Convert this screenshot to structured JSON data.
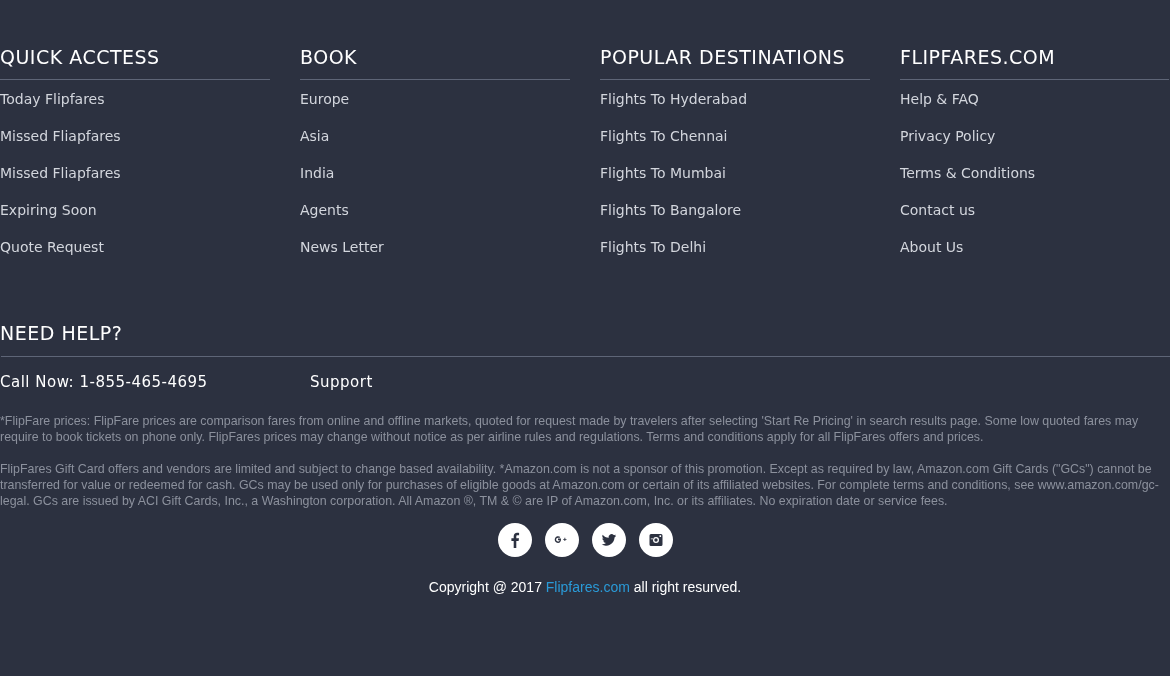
{
  "columns": [
    {
      "title": "QUICK ACCTESS",
      "links": [
        "Today Flipfares",
        "Missed Fliapfares",
        "Missed Fliapfares",
        "Expiring Soon",
        "Quote Request"
      ]
    },
    {
      "title": "BOOK",
      "links": [
        "Europe",
        "Asia",
        "India",
        "Agents",
        "News Letter"
      ]
    },
    {
      "title": "POPULAR DESTINATIONS",
      "links": [
        "Flights To Hyderabad",
        "Flights To Chennai",
        "Flights To Mumbai",
        "Flights To Bangalore",
        "Flights To Delhi"
      ]
    },
    {
      "title": "FLIPFARES.COM",
      "links": [
        "Help & FAQ",
        "Privacy Policy",
        "Terms & Conditions",
        "Contact us",
        "About Us"
      ]
    }
  ],
  "help": {
    "title": "NEED HELP?",
    "call": "Call Now: 1-855-465-4695",
    "support": "Support"
  },
  "disclaimers": [
    "*FlipFare prices: FlipFare prices are comparison fares from online and offline markets, quoted for request made by travelers after selecting 'Start Re Pricing' in search results page. Some low quoted fares may require to book tickets on phone only. FlipFares prices may change without notice as per airline rules and regulations. Terms and conditions apply for all FlipFares offers and prices.",
    "FlipFares Gift Card offers and vendors are limited and subject to change based availability. *Amazon.com is not a sponsor of this promotion. Except as required by law, Amazon.com Gift Cards (\"GCs\") cannot be transferred for value or redeemed for cash. GCs may be used only for purchases of eligible goods at Amazon.com or certain of its affiliated websites. For complete terms and conditions, see www.amazon.com/gc-legal. GCs are issued by ACI Gift Cards, Inc., a Washington corporation. All Amazon ®, TM & © are IP of Amazon.com, Inc. or its affiliates. No expiration date or service fees."
  ],
  "social": [
    {
      "kind": "facebook"
    },
    {
      "kind": "googleplus"
    },
    {
      "kind": "twitter"
    },
    {
      "kind": "instagram"
    }
  ],
  "copyright": {
    "before": "Copyright @ 2017",
    "link": "Flipfares.com",
    "after": "all right resurved."
  }
}
